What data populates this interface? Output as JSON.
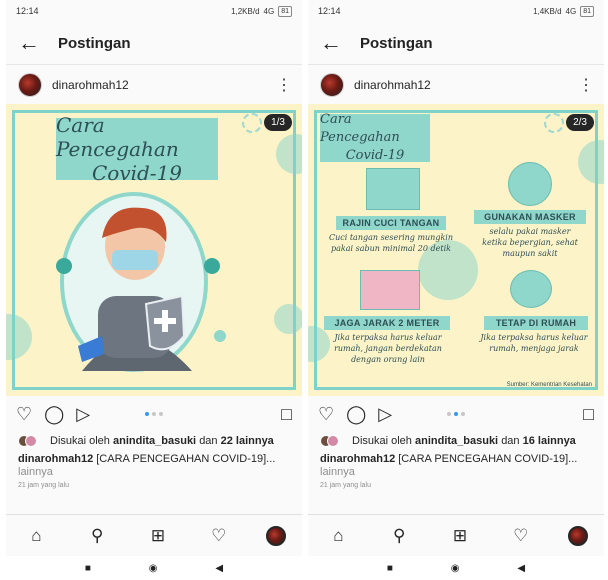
{
  "screens": [
    {
      "status": {
        "time": "12:14",
        "network": "1,2KB/d",
        "signal": "4G",
        "battery": "81"
      },
      "header": {
        "title": "Postingan"
      },
      "post": {
        "username": "dinarohmah12",
        "counter": "1/3",
        "slide_title_1": "Cara Pencegahan",
        "slide_title_2": "Covid-19",
        "likes_prefix": "Disukai oleh",
        "likes_user": "anindita_basuki",
        "likes_mid": "dan",
        "likes_count": "22 lainnya",
        "caption_user": "dinarohmah12",
        "caption_text": "[CARA PENCEGAHAN COVID-19]...",
        "more": "lainnya",
        "time": "21 jam yang lalu"
      }
    },
    {
      "status": {
        "time": "12:14",
        "network": "1,4KB/d",
        "signal": "4G",
        "battery": "81"
      },
      "header": {
        "title": "Postingan"
      },
      "post": {
        "username": "dinarohmah12",
        "counter": "2/3",
        "slide_title_1": "Cara Pencegahan",
        "slide_title_2": "Covid-19",
        "tips": [
          {
            "title": "RAJIN CUCI TANGAN",
            "desc_1": "Cuci tangan sesering mungkin",
            "desc_2": "pakai sabun  minimal 20 detik"
          },
          {
            "title": "GUNAKAN MASKER",
            "desc_1": "selalu pakai masker",
            "desc_2": "ketika bepergian, sehat",
            "desc_3": "maupun sakit"
          },
          {
            "title": "JAGA JARAK 2 METER",
            "desc_1": "Jika terpaksa harus keluar",
            "desc_2": "rumah, jangan berdekatan",
            "desc_3": "dengan orang lain"
          },
          {
            "title": "TETAP DI RUMAH",
            "desc_1": "Jika terpaksa harus keluar",
            "desc_2": "rumah, menjaga jarak"
          }
        ],
        "source": "Sumber: Kementrian Kesehatan",
        "likes_prefix": "Disukai oleh",
        "likes_user": "anindita_basuki",
        "likes_mid": "dan",
        "likes_count": "16 lainnya",
        "caption_user": "dinarohmah12",
        "caption_text": "[CARA PENCEGAHAN COVID-19]...",
        "more": "lainnya",
        "time": "21 jam yang lalu"
      }
    }
  ],
  "icons": {
    "back": "arrow-left",
    "more": "vertical-dots",
    "like": "heart",
    "comment": "speech-bubble",
    "share": "paper-plane",
    "bookmark": "bookmark",
    "home": "house",
    "search": "magnifier",
    "add": "plus-square",
    "activity": "heart",
    "profile": "avatar"
  },
  "colors": {
    "accent": "#3897f0",
    "slide_bg": "#fcf4c8",
    "slide_teal": "#8fd6cb",
    "slide_text": "#2e4f55"
  }
}
